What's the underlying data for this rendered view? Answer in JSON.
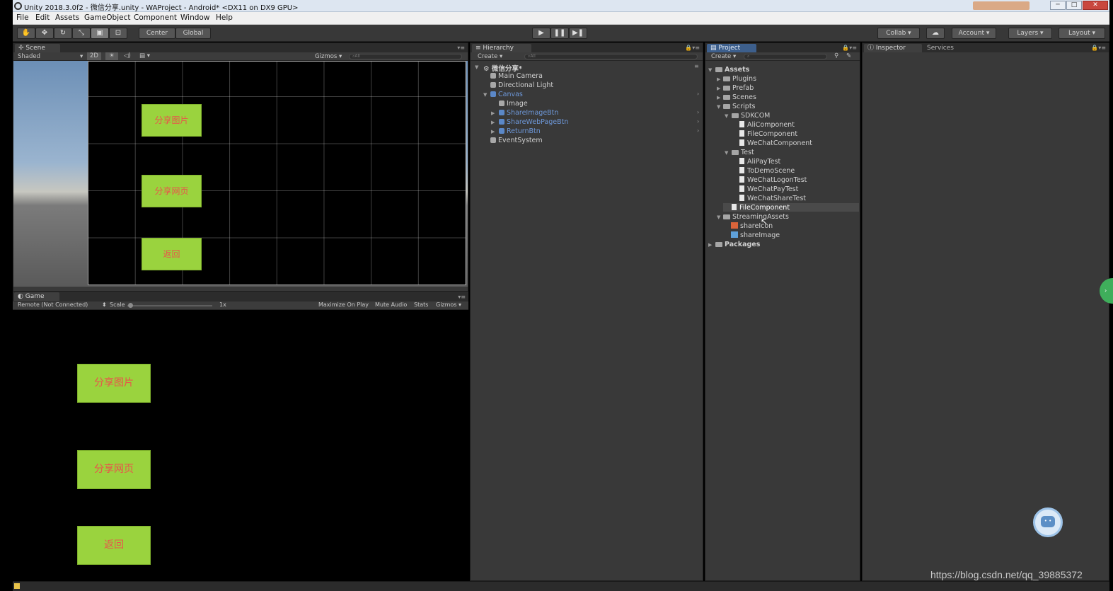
{
  "window": {
    "title": "Unity 2018.3.0f2 - 微信分享.unity - WAProject - Android* <DX11 on DX9 GPU>",
    "min": "─",
    "max": "□",
    "close": "✕"
  },
  "menu": [
    "File",
    "Edit",
    "Assets",
    "GameObject",
    "Component",
    "Window",
    "Help"
  ],
  "toolbar": {
    "pivot": "Center",
    "space": "Global",
    "collab": "Collab ▾",
    "account": "Account ▾",
    "layers": "Layers ▾",
    "layout": "Layout ▾"
  },
  "scene": {
    "tab": "Scene",
    "shading": "Shaded",
    "mode_2d": "2D",
    "gizmos": "Gizmos ▾",
    "search": "All",
    "buttons": [
      "分享图片",
      "分享网页",
      "返回"
    ]
  },
  "game": {
    "tab": "Game",
    "display": "Remote (Not Connected)",
    "scale_label": "Scale",
    "scale_value": "1x",
    "options": [
      "Maximize On Play",
      "Mute Audio",
      "Stats",
      "Gizmos ▾"
    ],
    "buttons": [
      "分享图片",
      "分享网页",
      "返回"
    ]
  },
  "hierarchy": {
    "tab": "Hierarchy",
    "create": "Create ▾",
    "search": "All",
    "scene_name": "微信分享*",
    "items": [
      {
        "label": "Main Camera",
        "color": "#d0d0d0"
      },
      {
        "label": "Directional Light",
        "color": "#d0d0d0"
      },
      {
        "label": "Canvas",
        "color": "#6d97d8"
      },
      {
        "label": "Image",
        "color": "#d0d0d0"
      },
      {
        "label": "ShareImageBtn",
        "color": "#6d97d8"
      },
      {
        "label": "ShareWebPageBtn",
        "color": "#6d97d8"
      },
      {
        "label": "ReturnBtn",
        "color": "#6d97d8"
      },
      {
        "label": "EventSystem",
        "color": "#d0d0d0"
      }
    ]
  },
  "project": {
    "tab": "Project",
    "create": "Create ▾",
    "assets": "Assets",
    "items": [
      "Plugins",
      "Prefab",
      "Scenes",
      "Scripts",
      "SDKCOM",
      "AliComponent",
      "FileComponent",
      "WeChatComponent",
      "Test",
      "AliPayTest",
      "ToDemoScene",
      "WeChatLogonTest",
      "WeChatPayTest",
      "WeChatShareTest",
      "FileComponent",
      "StreamingAssets",
      "shareIcon",
      "shareImage"
    ],
    "packages": "Packages"
  },
  "inspector": {
    "tab": "Inspector",
    "services": "Services"
  },
  "watermark": "https://blog.csdn.net/qq_39885372",
  "colors": {
    "button_bg": "#9ad33e",
    "button_text": "#e9544b",
    "editor_bg": "#393939"
  }
}
